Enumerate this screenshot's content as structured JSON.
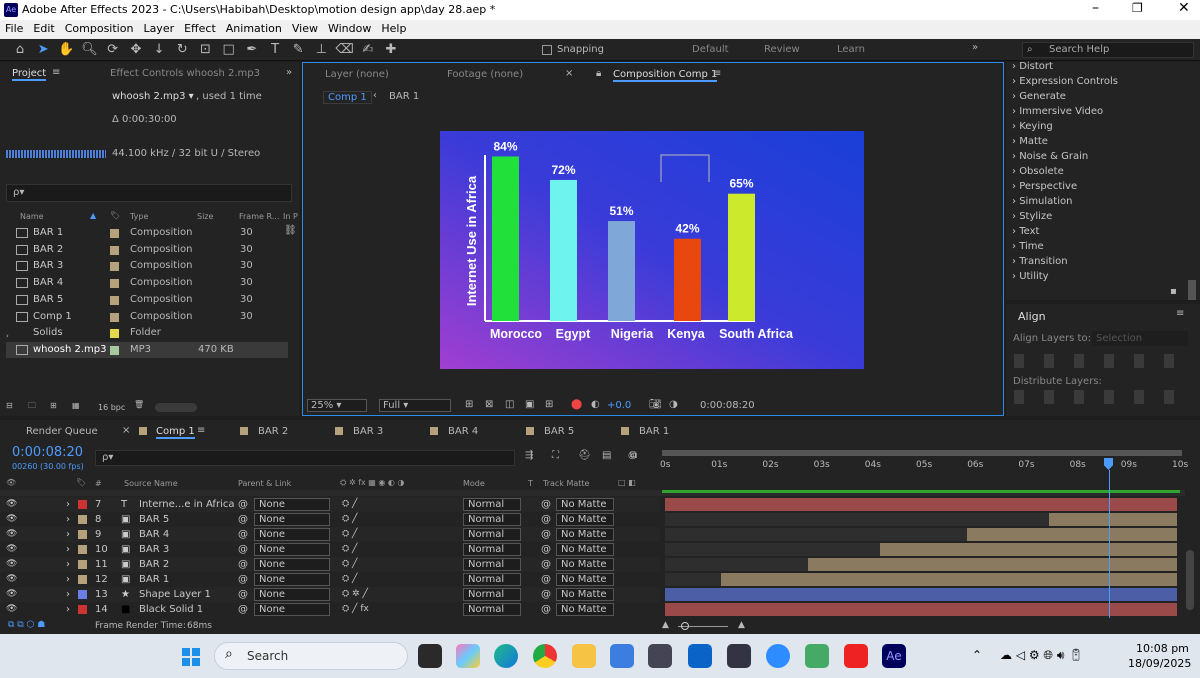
{
  "app": {
    "title": "Adobe After Effects 2023 - C:\\Users\\Habibah\\Desktop\\motion design app\\day 28.aep *",
    "icon": "Ae"
  },
  "menu": [
    "File",
    "Edit",
    "Composition",
    "Layer",
    "Effect",
    "Animation",
    "View",
    "Window",
    "Help"
  ],
  "toolbar": {
    "snapping": "Snapping",
    "workspaces": [
      "Default",
      "Review",
      "Learn"
    ],
    "search": "Search Help"
  },
  "project": {
    "tab": "Project",
    "effect_controls": "Effect Controls whoosh 2.mp3",
    "file_name": "whoosh 2.mp3 ▾",
    "file_used": ", used 1 time",
    "duration": "Δ 0:00:30:00",
    "audio_info": "44.100 kHz / 32 bit U / Stereo",
    "search_placeholder": "ρ▾",
    "columns": [
      "Name",
      "Type",
      "Size",
      "Frame R...",
      "In P"
    ],
    "items": [
      {
        "name": "BAR 1",
        "type": "Composition",
        "size": "",
        "fr": "30",
        "color": "#b5a17c"
      },
      {
        "name": "BAR 2",
        "type": "Composition",
        "size": "",
        "fr": "30",
        "color": "#b5a17c"
      },
      {
        "name": "BAR 3",
        "type": "Composition",
        "size": "",
        "fr": "30",
        "color": "#b5a17c"
      },
      {
        "name": "BAR 4",
        "type": "Composition",
        "size": "",
        "fr": "30",
        "color": "#b5a17c"
      },
      {
        "name": "BAR 5",
        "type": "Composition",
        "size": "",
        "fr": "30",
        "color": "#b5a17c"
      },
      {
        "name": "Comp 1",
        "type": "Composition",
        "size": "",
        "fr": "30",
        "color": "#b5a17c"
      },
      {
        "name": "Solids",
        "type": "Folder",
        "size": "",
        "fr": "",
        "color": "#e4d84c"
      },
      {
        "name": "whoosh 2.mp3",
        "type": "MP3",
        "size": "470 KB",
        "fr": "",
        "color": "#a8c8a0"
      }
    ],
    "bpc": "16 bpc"
  },
  "viewer": {
    "tabs_top": [
      "Layer (none)",
      "Footage (none)",
      "Composition Comp 1"
    ],
    "subtabs": [
      "Comp 1",
      "BAR 1"
    ],
    "zoom": "25%",
    "quality": "Full",
    "exposure": "+0.0",
    "timecode": "0:00:08:20"
  },
  "chart_data": {
    "type": "bar",
    "title": "",
    "ylabel": "Internet Use in Africa",
    "xlabel": "",
    "categories": [
      "Morocco",
      "Egypt",
      "Nigeria",
      "Kenya",
      "South Africa"
    ],
    "values": [
      84,
      72,
      51,
      42,
      65
    ],
    "labels": [
      "84%",
      "72%",
      "51%",
      "42%",
      "65%"
    ],
    "colors": [
      "#22e03a",
      "#6ef3ee",
      "#7fa8d8",
      "#e8480f",
      "#cde92c"
    ],
    "ylim": [
      0,
      100
    ]
  },
  "effects": [
    "Distort",
    "Expression Controls",
    "Generate",
    "Immersive Video",
    "Keying",
    "Matte",
    "Noise & Grain",
    "Obsolete",
    "Perspective",
    "Simulation",
    "Stylize",
    "Text",
    "Time",
    "Transition",
    "Utility"
  ],
  "align": {
    "title": "Align",
    "align_to_label": "Align Layers to:",
    "align_to_value": "Selection",
    "distribute": "Distribute Layers:"
  },
  "timeline": {
    "tabs": [
      "Render Queue",
      "Comp 1",
      "BAR 2",
      "BAR 3",
      "BAR 4",
      "BAR 5",
      "BAR 1"
    ],
    "timecode": "0:00:08:20",
    "frames": "00260 (30.00 fps)",
    "ruler": [
      "0s",
      "01s",
      "02s",
      "03s",
      "04s",
      "05s",
      "06s",
      "07s",
      "08s",
      "09s",
      "10s"
    ],
    "col_headers": [
      "#",
      "Source Name",
      "Parent & Link",
      "Mode",
      "T",
      "Track Matte"
    ],
    "layers": [
      {
        "num": "7",
        "name": "Interne...e in Africa",
        "kind": "T",
        "parent": "None",
        "mode": "Normal",
        "matte": "No Matte",
        "color": "#c33",
        "start": 0.0,
        "bar": "#9b4a4a"
      },
      {
        "num": "8",
        "name": "BAR 5",
        "kind": "comp",
        "parent": "None",
        "mode": "Normal",
        "matte": "No Matte",
        "color": "#b5a17c",
        "start": 0.75,
        "bar": "#8a7b60"
      },
      {
        "num": "9",
        "name": "BAR 4",
        "kind": "comp",
        "parent": "None",
        "mode": "Normal",
        "matte": "No Matte",
        "color": "#b5a17c",
        "start": 0.59,
        "bar": "#8a7b60"
      },
      {
        "num": "10",
        "name": "BAR 3",
        "kind": "comp",
        "parent": "None",
        "mode": "Normal",
        "matte": "No Matte",
        "color": "#b5a17c",
        "start": 0.42,
        "bar": "#8a7b60"
      },
      {
        "num": "11",
        "name": "BAR 2",
        "kind": "comp",
        "parent": "None",
        "mode": "Normal",
        "matte": "No Matte",
        "color": "#b5a17c",
        "start": 0.28,
        "bar": "#8a7b60"
      },
      {
        "num": "12",
        "name": "BAR 1",
        "kind": "comp",
        "parent": "None",
        "mode": "Normal",
        "matte": "No Matte",
        "color": "#b5a17c",
        "start": 0.11,
        "bar": "#8a7b60"
      },
      {
        "num": "13",
        "name": "Shape Layer 1",
        "kind": "shape",
        "parent": "None",
        "mode": "Normal",
        "matte": "No Matte",
        "color": "#6c7ee6",
        "start": 0.0,
        "bar": "#4b5ea6"
      },
      {
        "num": "14",
        "name": "Black Solid 1",
        "kind": "solid",
        "parent": "None",
        "mode": "Normal",
        "matte": "No Matte",
        "color": "#c33",
        "start": 0.0,
        "bar": "#9b4a4a"
      }
    ],
    "render_time": "Frame Render Time:",
    "render_ms": "68ms"
  },
  "taskbar": {
    "search": "Search",
    "time": "10:08 pm",
    "date": "18/09/2025"
  }
}
